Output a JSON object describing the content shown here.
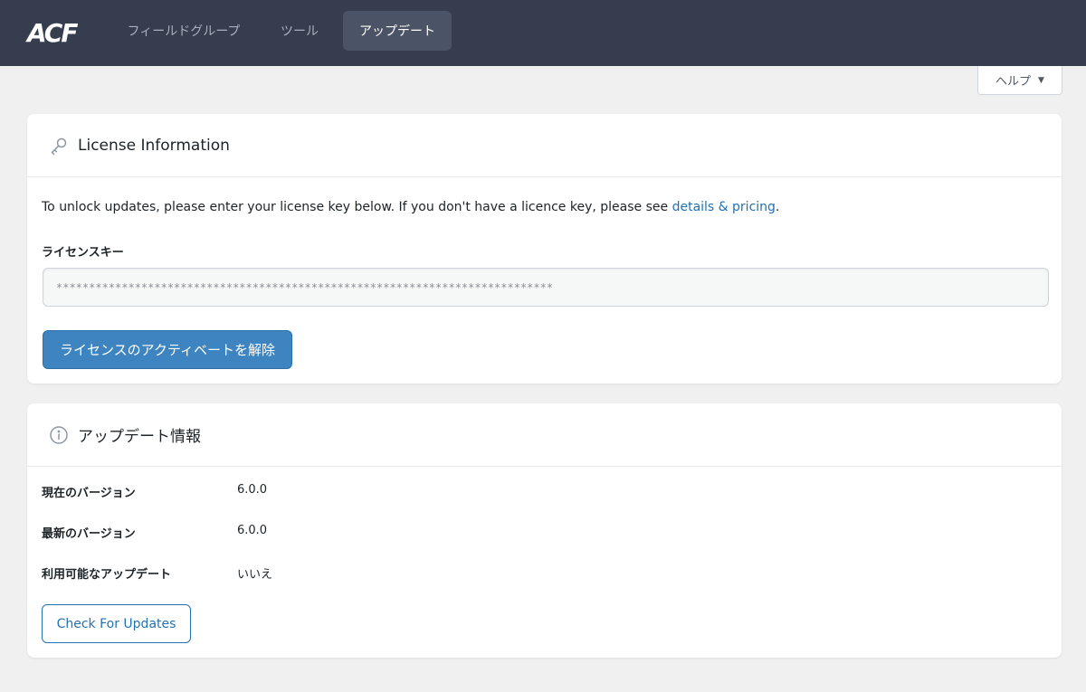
{
  "topbar": {
    "logo": "ACF",
    "tabs": [
      {
        "label": "フィールドグループ"
      },
      {
        "label": "ツール"
      },
      {
        "label": "アップデート"
      }
    ]
  },
  "help": {
    "label": "ヘルプ",
    "caret": "▼"
  },
  "license": {
    "title": "License Information",
    "text_before": "To unlock updates, please enter your license key below. If you don't have a licence key, please see ",
    "link": "details & pricing",
    "text_after": ".",
    "key_label": "ライセンスキー",
    "key_value": "****************************************************************************",
    "deactivate_button": "ライセンスのアクティベートを解除"
  },
  "update": {
    "title": "アップデート情報",
    "rows": [
      {
        "label": "現在のバージョン",
        "value": "6.0.0"
      },
      {
        "label": "最新のバージョン",
        "value": "6.0.0"
      },
      {
        "label": "利用可能なアップデート",
        "value": "いいえ"
      }
    ],
    "check_button": "Check For Updates"
  },
  "colors": {
    "topbar": "#353d4f",
    "active_tab": "#4b5466",
    "primary": "#3e84c1",
    "link": "#2271b1"
  },
  "icons": [
    "key-icon",
    "info-icon",
    "caret-down-icon"
  ]
}
